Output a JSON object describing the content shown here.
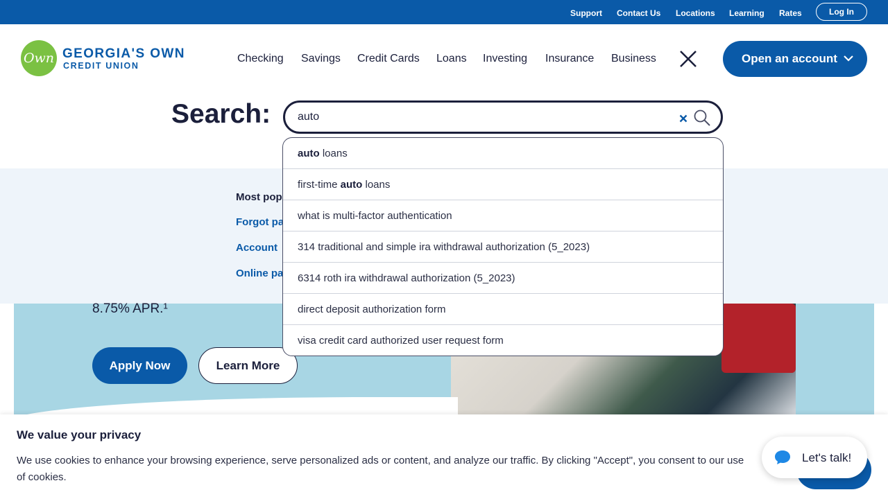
{
  "utility_nav": {
    "links": [
      "Support",
      "Contact Us",
      "Locations",
      "Learning",
      "Rates"
    ],
    "login_label": "Log In"
  },
  "brand": {
    "logo_mark": "Own",
    "name_line1": "GEORGIA'S OWN",
    "name_line2": "CREDIT UNION",
    "color_primary": "#0a5aa8",
    "color_logo": "#7bc143"
  },
  "main_nav": {
    "items": [
      "Checking",
      "Savings",
      "Credit Cards",
      "Loans",
      "Investing",
      "Insurance",
      "Business"
    ],
    "close_icon": "close-icon",
    "open_account_label": "Open an account"
  },
  "search": {
    "label": "Search:",
    "value": "auto",
    "suggestions": [
      {
        "bold": "auto",
        "after": " loans",
        "before": ""
      },
      {
        "before": "first-time ",
        "bold": "auto",
        "after": " loans"
      },
      {
        "before": "what is multi-factor authentication",
        "bold": "",
        "after": ""
      },
      {
        "before": "314 traditional and simple ira withdrawal authorization (5_2023)",
        "bold": "",
        "after": ""
      },
      {
        "before": "6314 roth ira withdrawal authorization (5_2023)",
        "bold": "",
        "after": ""
      },
      {
        "before": "direct deposit authorization form",
        "bold": "",
        "after": ""
      },
      {
        "before": "visa credit card authorized user request form",
        "bold": "",
        "after": ""
      }
    ]
  },
  "popular": {
    "title": "Most pop",
    "links": [
      "Forgot pa",
      "Account",
      "Online pa"
    ]
  },
  "hero": {
    "apr_text": "8.75% APR.¹",
    "apply_label": "Apply Now",
    "learn_label": "Learn More"
  },
  "cookie": {
    "title": "We value your privacy",
    "text": "We use cookies to enhance your browsing experience, serve personalized ads or content, and analyze our traffic. By clicking \"Accept\", you consent to our use of cookies."
  },
  "chat": {
    "label": "Let's talk!"
  }
}
